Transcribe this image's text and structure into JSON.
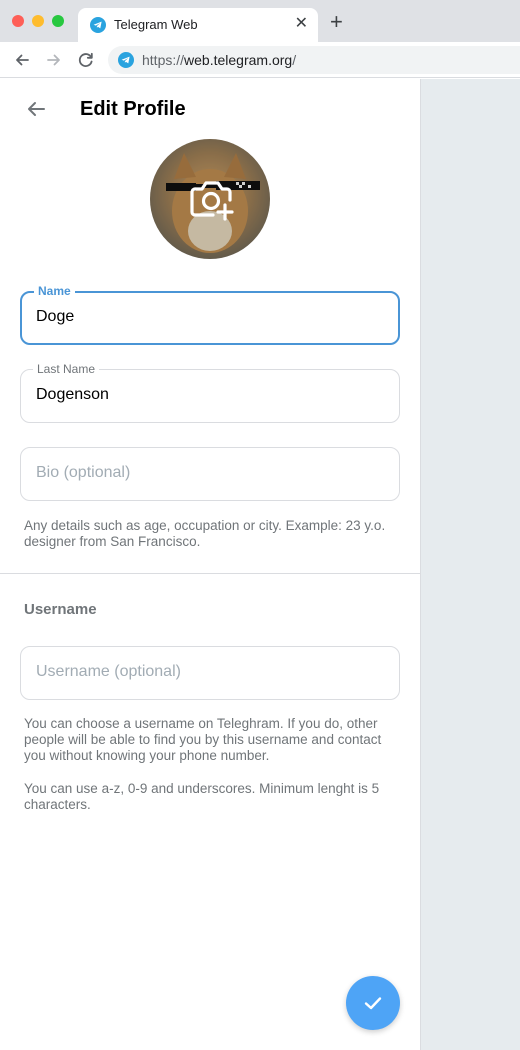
{
  "browser": {
    "tab_title": "Telegram Web",
    "close_glyph": "✕",
    "new_tab_glyph": "+",
    "url_scheme": "https://",
    "url_host": "web.telegram.org",
    "url_path": "/"
  },
  "header": {
    "title": "Edit Profile"
  },
  "form": {
    "name": {
      "label": "Name",
      "value": "Doge"
    },
    "last_name": {
      "label": "Last Name",
      "value": "Dogenson"
    },
    "bio": {
      "placeholder": "Bio (optional)"
    },
    "bio_hint": "Any details such as age, occupation or city. Example: 23 y.o. designer from San Francisco."
  },
  "username_section": {
    "title": "Username",
    "placeholder": "Username (optional)",
    "hint1": "You can choose a username on Teleghram. If you do, other people will be able to find you by this username and contact you without knowing your phone number.",
    "hint2": "You can use a-z, 0-9 and underscores. Minimum lenght is 5 characters."
  },
  "colors": {
    "accent": "#4a95d6",
    "fab": "#4ea4f6",
    "hint_text": "#707579",
    "placeholder": "#a2acb4",
    "right_pane": "#e6ebee"
  },
  "icons": {
    "back": "arrow-left-icon",
    "camera": "camera-add-icon",
    "confirm": "check-icon",
    "favicon": "telegram-icon"
  }
}
